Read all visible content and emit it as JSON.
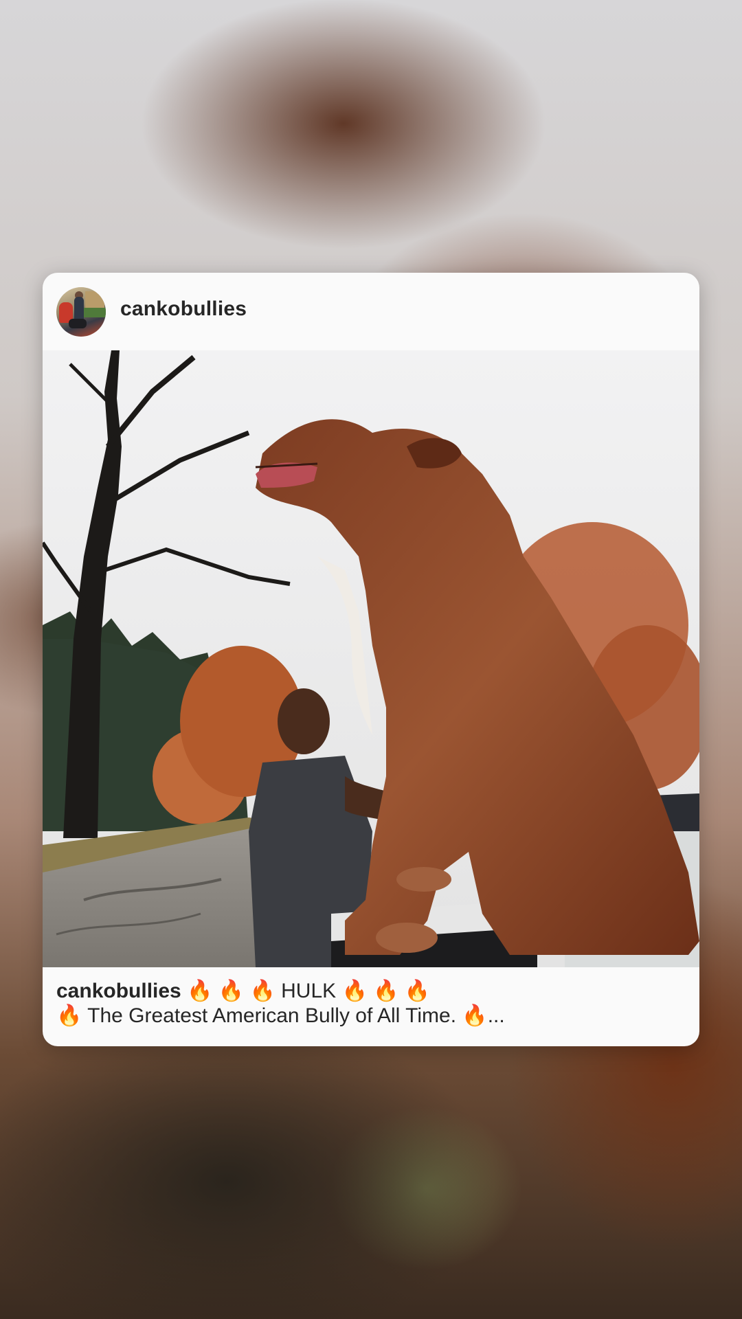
{
  "post": {
    "username": "cankobullies",
    "caption_user": "cankobullies",
    "caption_line1": "🔥 🔥 🔥 HULK 🔥 🔥 🔥",
    "caption_line2": "🔥 The Greatest American Bully of All Time. 🔥..."
  },
  "icons": {
    "avatar": "profile-avatar",
    "photo": "post-photo"
  },
  "colors": {
    "card_background": "#fafafa",
    "text": "#262626"
  }
}
